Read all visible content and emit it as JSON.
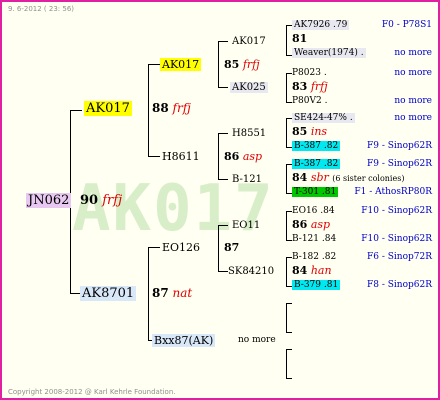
{
  "header": {
    "date": "9. 6-2012 ( 23: 56)"
  },
  "footer": {
    "copyright": "Copyright 2008-2012 @ Karl Kehrle Foundation."
  },
  "root": {
    "name": "JN062",
    "num": "90",
    "race": "frfj"
  },
  "gen1": {
    "top": {
      "name": "AK017",
      "num": "88",
      "race": "frfj"
    },
    "bottom": {
      "name": "AK8701",
      "num": "87",
      "race": "nat"
    }
  },
  "gen2": {
    "a": {
      "name": "AK017",
      "num": "85",
      "race": "frfj"
    },
    "b": {
      "name": "H8611",
      "num": "86",
      "race": "asp"
    },
    "c": {
      "name": "EO126",
      "num": "87"
    },
    "d": {
      "name": "Bxx87(AK)",
      "note": "no more"
    }
  },
  "gen3": {
    "a1": "AK017",
    "a2": "AK025",
    "b1": "H8551",
    "b2": "B-121",
    "c1": "EO11",
    "c2": "SK84210"
  },
  "gen3_detail": {
    "a": {
      "l1": "AK7926 .79",
      "r1": "F0 - P78S1",
      "num": "81",
      "l3": "Weaver(1974) .",
      "r3": "no more"
    },
    "b": {
      "l1": "P8023 .",
      "r1": "no more",
      "num": "83",
      "race": "frfj",
      "l3": "P80V2 .",
      "r3": "no more"
    },
    "c": {
      "l1": "SE424-47% .",
      "r1": "no more",
      "num": "85",
      "race": "ins",
      "l3": "B-387 .82",
      "r3": "F9 - Sinop62R"
    },
    "d": {
      "l1": "B-387 .82",
      "r1": "F9 - Sinop62R",
      "num": "84",
      "race": "sbr",
      "extra": "(6 sister colonies)",
      "l3": "T-301 .81",
      "r3": "F1 - AthosRP80R"
    },
    "e": {
      "l1": "EO16 .84",
      "r1": "F10 - Sinop62R",
      "num": "86",
      "race": "asp",
      "l3": "B-121 .84",
      "r3": "F10 - Sinop62R"
    },
    "f": {
      "l1": "B-182 .82",
      "r1": "F6 - Sinop72R",
      "num": "84",
      "race": "han",
      "l3": "B-379 .81",
      "r3": "F8 - Sinop62R"
    }
  },
  "watermark": {
    "text": "AK017",
    "color": "#c8e8b8"
  }
}
